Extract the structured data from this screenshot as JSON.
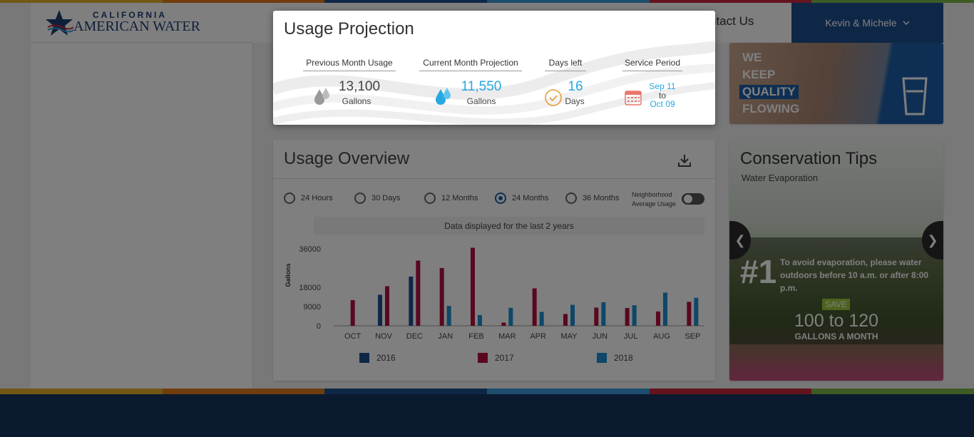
{
  "colors": {
    "brand_blue": "#1d5fa6",
    "bar_2016": "#1f4f8f",
    "bar_2017": "#b2103f",
    "bar_2018": "#1c8fd1",
    "projection_blue": "#27a8e0",
    "footer": "#17355c",
    "stripes": [
      "#e2b128",
      "#e07a1c",
      "#1f4f8f",
      "#3b9ad9",
      "#c8283c",
      "#7ab648"
    ]
  },
  "brand": {
    "line1": "CALIFORNIA",
    "line2": "AMERICAN WATER",
    "icon": "star-logo-icon"
  },
  "header": {
    "contact_link": "ntact Us",
    "user_name": "Kevin & Michele"
  },
  "promo": {
    "lines": [
      "WE",
      "KEEP",
      "QUALITY",
      "FLOWING"
    ],
    "icon": "water-glass-icon"
  },
  "usage_projection": {
    "title": "Usage Projection",
    "previous_month": {
      "label": "Previous Month Usage",
      "value": "13,100",
      "unit": "Gallons",
      "icon": "water-drops-gray-icon"
    },
    "current_month": {
      "label": "Current Month Projection",
      "value": "11,550",
      "unit": "Gallons",
      "icon": "water-drops-blue-icon"
    },
    "days_left": {
      "label": "Days left",
      "value": "16",
      "unit": "Days",
      "icon": "clock-check-icon"
    },
    "service_period": {
      "label": "Service Period",
      "start": "Sep 11",
      "to": "to",
      "end": "Oct 09",
      "icon": "calendar-icon"
    }
  },
  "usage_overview": {
    "title": "Usage Overview",
    "download_icon": "download-icon",
    "ranges": [
      {
        "label": "24 Hours",
        "selected": false
      },
      {
        "label": "30 Days",
        "selected": false
      },
      {
        "label": "12 Months",
        "selected": false
      },
      {
        "label": "24 Months",
        "selected": true
      },
      {
        "label": "36 Months",
        "selected": false
      }
    ],
    "neighborhood_toggle": {
      "line1": "Neighborhood",
      "line2": "Average Usage",
      "on": false
    },
    "note": "Data displayed for the last 2 years",
    "legend": [
      "2016",
      "2017",
      "2018"
    ]
  },
  "chart_data": {
    "type": "bar",
    "ylabel": "Gallons",
    "yticks": [
      0,
      9000,
      18000,
      36000
    ],
    "ylim": [
      0,
      36000
    ],
    "categories": [
      "OCT",
      "NOV",
      "DEC",
      "JAN",
      "FEB",
      "MAR",
      "APR",
      "MAY",
      "JUN",
      "JUL",
      "AUG",
      "SEP"
    ],
    "series": [
      {
        "name": "2016",
        "values": [
          null,
          14500,
          23000,
          null,
          null,
          null,
          null,
          null,
          null,
          null,
          null,
          null
        ]
      },
      {
        "name": "2017",
        "values": [
          12000,
          18500,
          30500,
          27000,
          36500,
          1500,
          17500,
          5500,
          8500,
          8300,
          6700,
          11200
        ]
      },
      {
        "name": "2018",
        "values": [
          null,
          null,
          null,
          9300,
          5000,
          8400,
          6500,
          9800,
          11000,
          9600,
          15500,
          13100
        ]
      }
    ],
    "grid": false,
    "legend_position": "bottom"
  },
  "conservation_tips": {
    "title": "Conservation Tips",
    "subtitle": "Water Evaporation",
    "number": "#1",
    "text": "To avoid evaporation, please water outdoors before 10 a.m. or after 8:00 p.m.",
    "save_label": "SAVE",
    "amount": "100 to 120",
    "unit": "GALLONS A MONTH",
    "prev_icon": "chevron-left-icon",
    "next_icon": "chevron-right-icon"
  }
}
